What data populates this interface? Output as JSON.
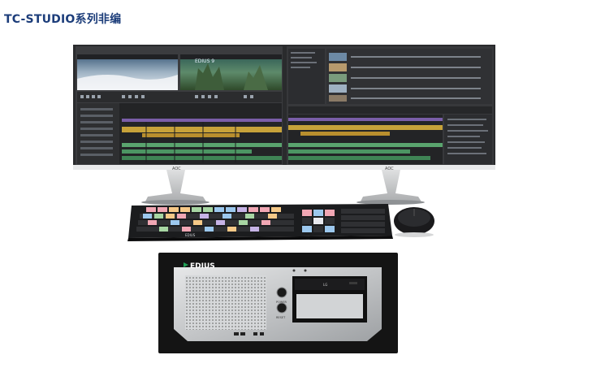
{
  "header": {
    "title": "TC-STUDIO系列非编"
  },
  "monitors": {
    "brand": "AOC",
    "left_screen_badge": "EDIUS 9"
  },
  "keyboard": {
    "brand_label": "EDIUS"
  },
  "workstation": {
    "brand": "EDIUS",
    "power_label": "POWER",
    "reset_label": "RESET",
    "drive_brand": "LG"
  },
  "colors": {
    "title": "#1c3d7a",
    "edius_green": "#1fa055",
    "chassis_black": "#141414",
    "chassis_silver": "#c9cbcd"
  }
}
